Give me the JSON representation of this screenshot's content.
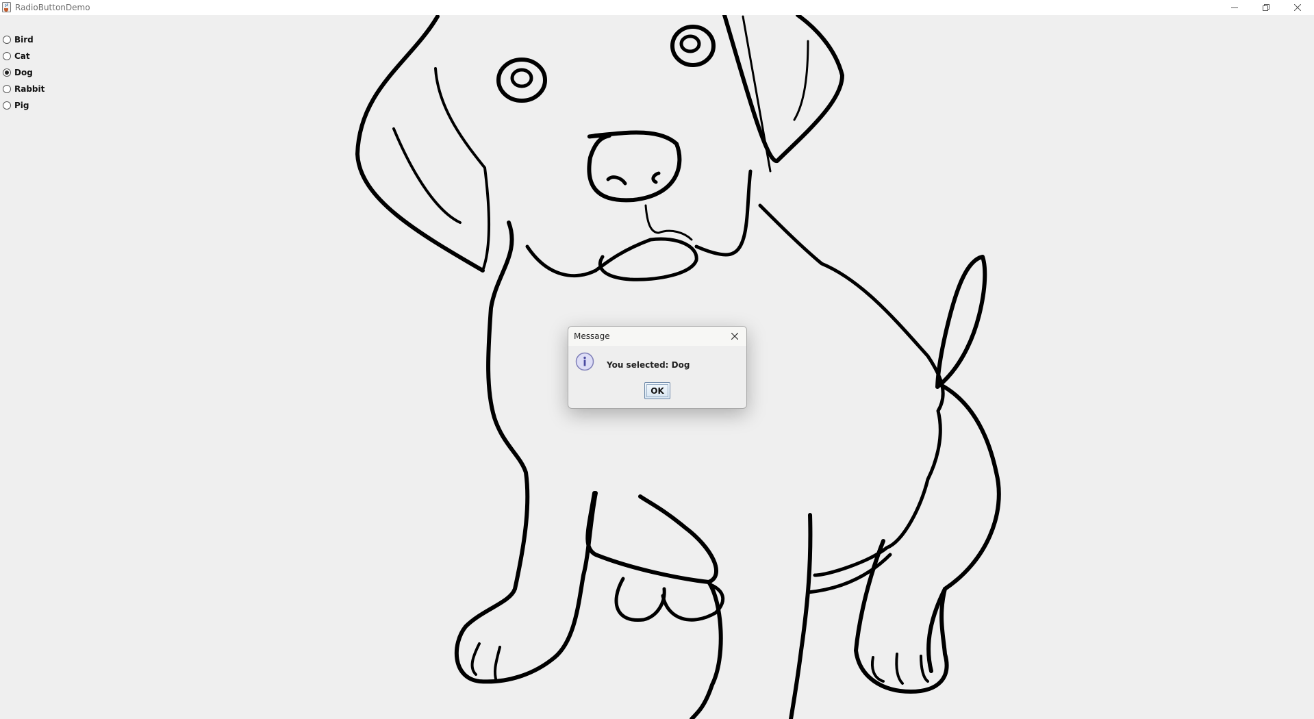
{
  "window": {
    "title": "RadioButtonDemo",
    "icons": {
      "app": "java-cup-icon",
      "minimize": "minimize-icon",
      "restore": "restore-icon",
      "close": "close-icon"
    }
  },
  "radio_group": {
    "selected": "Dog",
    "options": [
      {
        "label": "Bird",
        "checked": false
      },
      {
        "label": "Cat",
        "checked": false
      },
      {
        "label": "Dog",
        "checked": true
      },
      {
        "label": "Rabbit",
        "checked": false
      },
      {
        "label": "Pig",
        "checked": false
      }
    ]
  },
  "picture": {
    "subject": "dog-line-art"
  },
  "dialog": {
    "title": "Message",
    "message": "You selected: Dog",
    "ok_label": "OK",
    "icon": "information-icon",
    "close_icon": "close-icon"
  },
  "colors": {
    "window_background": "#efefef",
    "title_bar": "#ffffff",
    "line_art": "#000000",
    "dialog_background": "#eeeeee",
    "ok_button_border": "#6b86a6",
    "info_icon_fill": "#ddddf6"
  }
}
